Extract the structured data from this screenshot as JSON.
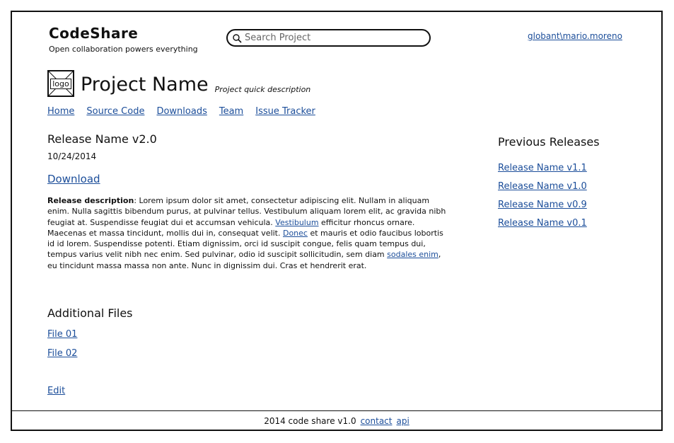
{
  "brand": {
    "title": "CodeShare",
    "tagline": "Open collaboration powers everything"
  },
  "search": {
    "placeholder": "Search Project",
    "icon": "magnifier-icon"
  },
  "user": {
    "name": "globant\\mario.moreno"
  },
  "project": {
    "logo_label": "logo",
    "name": "Project Name",
    "description": "Project quick description"
  },
  "nav": {
    "items": [
      {
        "label": "Home"
      },
      {
        "label": "Source Code"
      },
      {
        "label": "Downloads"
      },
      {
        "label": "Team"
      },
      {
        "label": "Issue Tracker"
      }
    ]
  },
  "release": {
    "name": "Release Name v2.0",
    "date": "10/24/2014",
    "download_label": "Download",
    "description_label": "Release description",
    "description_parts": [
      ": Lorem ipsum dolor sit amet, consectetur adipiscing elit. Nullam in aliquam enim. Nulla sagittis bibendum purus, at pulvinar tellus. Vestibulum aliquam lorem elit, ac gravida nibh feugiat at. Suspendisse feugiat dui et accumsan vehicula. ",
      "Vestibulum",
      " efficitur rhoncus ornare. Maecenas et massa tincidunt, mollis dui in, consequat velit. ",
      "Donec",
      " et mauris et odio faucibus lobortis id id lorem. Suspendisse potenti. Etiam dignissim, orci id suscipit congue, felis quam tempus dui, tempus varius velit nibh nec enim. Sed pulvinar, odio id suscipit sollicitudin, sem diam ",
      "sodales enim",
      ", eu tincidunt massa massa non ante. Nunc in dignissim dui. Cras et hendrerit erat."
    ]
  },
  "additional_files": {
    "title": "Additional Files",
    "files": [
      {
        "label": "File 01"
      },
      {
        "label": "File 02"
      }
    ]
  },
  "edit_label": "Edit",
  "previous_releases": {
    "title": "Previous Releases",
    "items": [
      {
        "label": "Release Name v1.1"
      },
      {
        "label": "Release Name v1.0"
      },
      {
        "label": "Release Name v0.9"
      },
      {
        "label": "Release Name v0.1"
      }
    ]
  },
  "footer": {
    "text": "2014 code share v1.0",
    "contact_label": "contact",
    "api_label": "api"
  },
  "colors": {
    "link": "#1c4e9a",
    "border": "#111111"
  }
}
